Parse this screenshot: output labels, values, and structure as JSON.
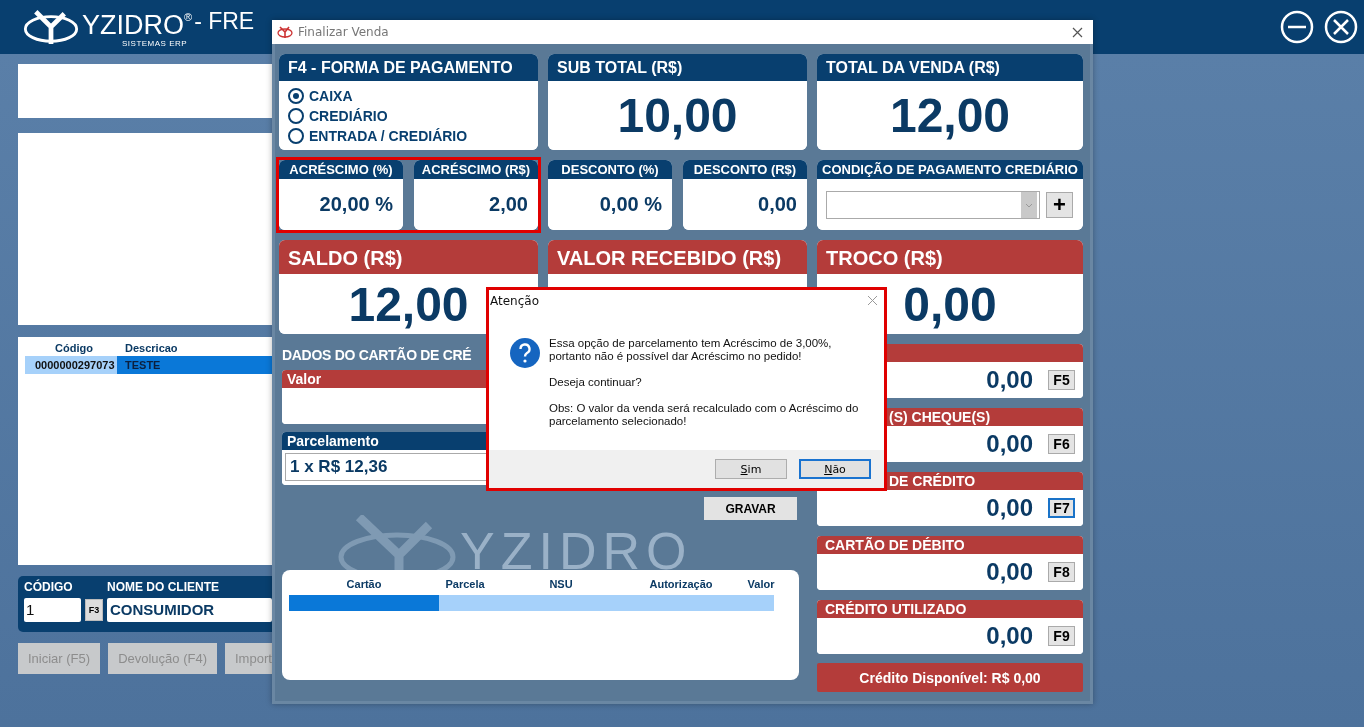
{
  "app": {
    "logo": "YZIDRO",
    "logo_mark": "®",
    "logo_sub": "SISTEMAS ERP",
    "title": "- FRE",
    "table": {
      "columns": [
        "Código",
        "Descricao"
      ],
      "rows": [
        {
          "cells": [
            "0000000297073",
            "TESTE"
          ],
          "selected": true
        }
      ]
    },
    "client": {
      "code_label": "CÓDIGO",
      "name_label": "NOME DO CLIENTE",
      "code": "1",
      "lookup_key": "F3",
      "name": "CONSUMIDOR"
    },
    "buttons": [
      {
        "label": "Iniciar (F5)",
        "disabled": true
      },
      {
        "label": "Devolução (F4)",
        "disabled": true
      },
      {
        "label": "Import",
        "disabled": true
      }
    ]
  },
  "window": {
    "title": "Finalizar Venda",
    "payment_form": {
      "title": "F4 - FORMA DE PAGAMENTO",
      "options": [
        {
          "label": "CAIXA",
          "selected": true
        },
        {
          "label": "CREDIÁRIO",
          "selected": false
        },
        {
          "label": "ENTRADA / CREDIÁRIO",
          "selected": false
        }
      ]
    },
    "subtotal": {
      "label": "SUB TOTAL (R$)",
      "value": "10,00"
    },
    "total": {
      "label": "TOTAL DA VENDA (R$)",
      "value": "12,00"
    },
    "surcharges": {
      "highlighted": true,
      "items": [
        {
          "label": "ACRÉSCIMO (%)",
          "value": "20,00 %"
        },
        {
          "label": "ACRÉSCIMO (R$)",
          "value": "2,00"
        }
      ]
    },
    "discounts": [
      {
        "label": "DESCONTO (%)",
        "value": "0,00 %"
      },
      {
        "label": "DESCONTO (R$)",
        "value": "0,00"
      }
    ],
    "credit_condition": {
      "label": "CONDIÇÃO DE PAGAMENTO CREDIÁRIO",
      "add_button": "+"
    },
    "balances": [
      {
        "label": "SALDO (R$)",
        "value": "12,00"
      },
      {
        "label": "VALOR RECEBIDO (R$)"
      },
      {
        "label": "TROCO (R$)",
        "value": "0,00"
      }
    ],
    "card_data": {
      "title": "DADOS DO CARTÃO DE CRÉ",
      "value_label": "Valor",
      "installments_label": "Parcelamento",
      "installments": "1 x R$ 12,36",
      "save_button": "GRAVAR",
      "table": {
        "columns": [
          "Cartão",
          "Parcela",
          "NSU",
          "Autorização",
          "Valor"
        ],
        "rows": [
          {
            "selected": true
          }
        ]
      }
    },
    "watermark": "YZIDRO",
    "payments": [
      {
        "value": "0,00",
        "key": "F5",
        "focused": false
      },
      {
        "label": "(S) CHEQUE(S)",
        "covered": true,
        "value": "0,00",
        "key": "F6",
        "focused": false
      },
      {
        "label": "DE CRÉDITO",
        "covered": true,
        "value": "0,00",
        "key": "F7",
        "focused": true
      },
      {
        "label": "CARTÃO DE DÉBITO",
        "value": "0,00",
        "key": "F8",
        "focused": false
      },
      {
        "label": "CRÉDITO UTILIZADO",
        "value": "0,00",
        "key": "F9",
        "focused": false
      }
    ],
    "available_credit": "Crédito Disponível: R$ 0,00"
  },
  "dialog": {
    "title": "Atenção",
    "highlighted": true,
    "paragraphs": [
      "Essa opção de parcelamento tem Acréscimo de 3,00%, portanto não é possível dar Acréscimo no pedido!",
      "Deseja continuar?",
      "Obs: O valor da venda será recalculado com o Acréscimo do parcelamento selecionado!"
    ],
    "buttons": [
      {
        "key": "S",
        "rest": "im",
        "selected": false
      },
      {
        "key": "N",
        "rest": "ão",
        "selected": true
      }
    ]
  }
}
